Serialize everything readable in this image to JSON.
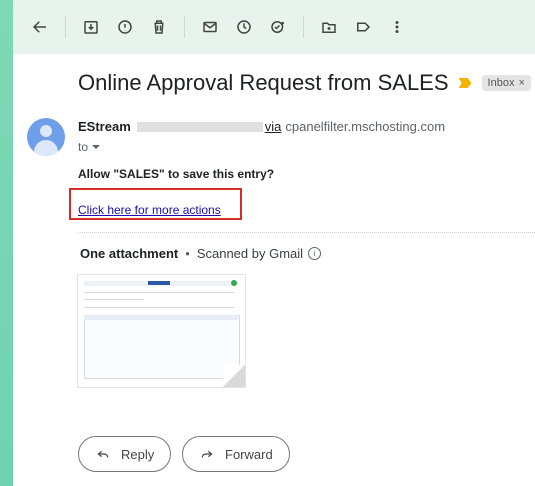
{
  "email": {
    "subject": "Online Approval Request from SALES",
    "label": "Inbox",
    "label_close": "×",
    "sender_name": "EStream",
    "via_text": "via",
    "via_domain": "cpanelfilter.mschosting.com",
    "to_text": "to",
    "body_question": "Allow \"SALES\" to save this entry?",
    "action_link": "Click here for more actions"
  },
  "attachments": {
    "title": "One attachment",
    "separator": "•",
    "scanned": "Scanned by Gmail",
    "info": "i"
  },
  "actions": {
    "reply": "Reply",
    "forward": "Forward"
  },
  "toolbar_icons": [
    "back-arrow-icon",
    "archive-icon",
    "report-spam-icon",
    "delete-icon",
    "mark-unread-icon",
    "snooze-icon",
    "add-to-tasks-icon",
    "move-to-icon",
    "label-icon",
    "more-options-icon"
  ],
  "colors": {
    "accent_link": "#1a0dab",
    "highlight_box": "#d92a2a",
    "avatar": "#6f9fea",
    "importance": "#f3b400"
  }
}
